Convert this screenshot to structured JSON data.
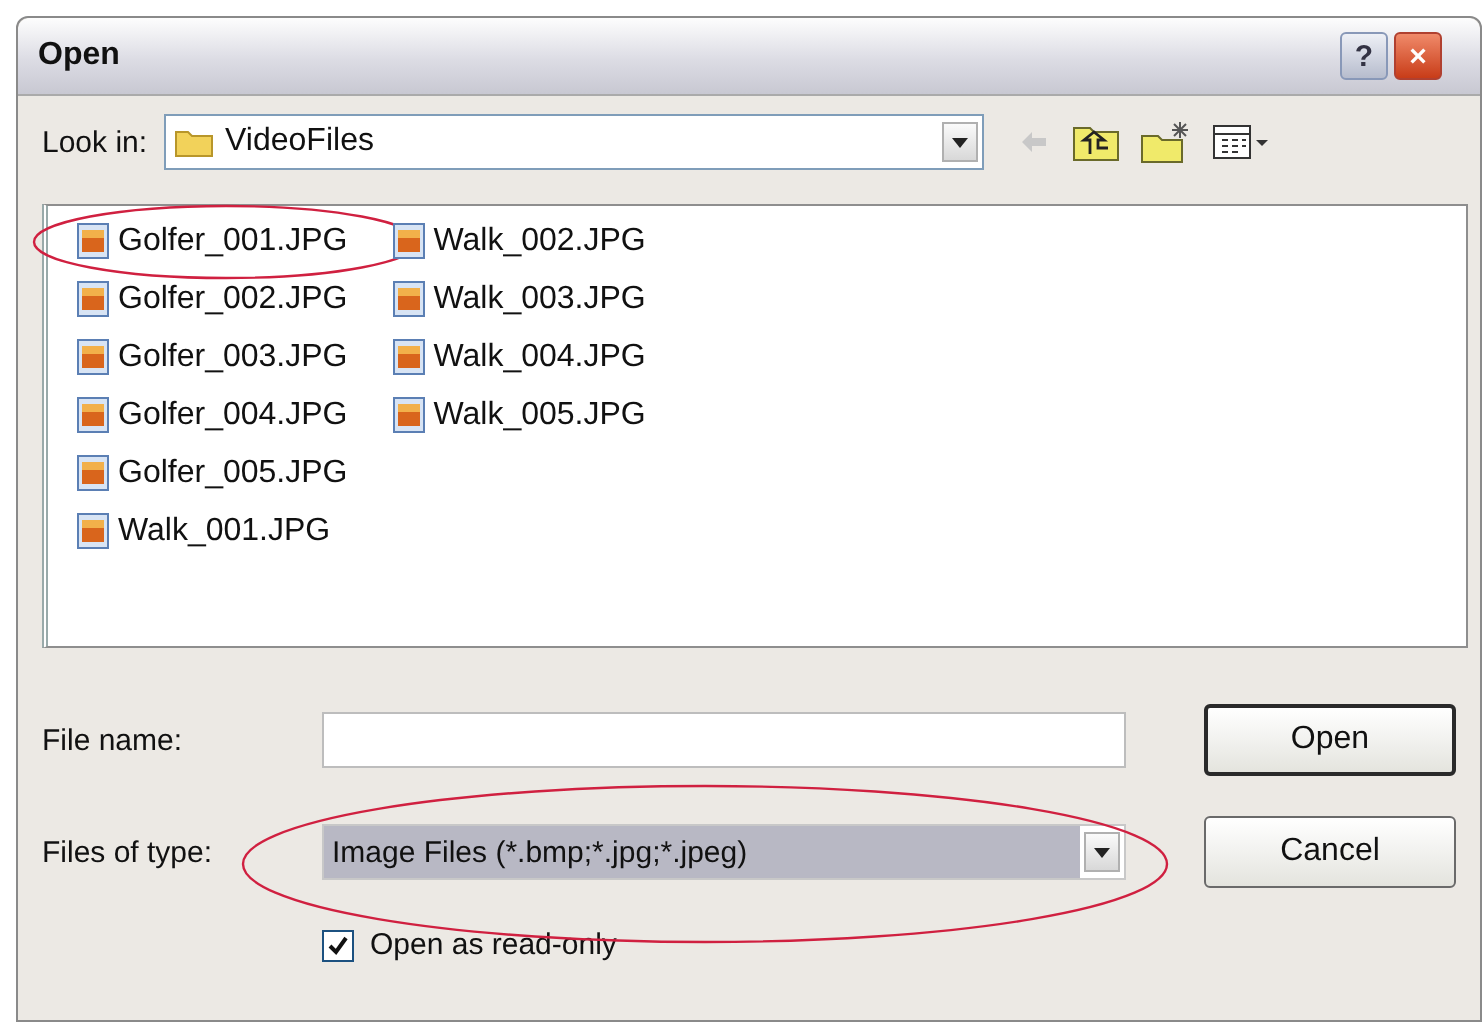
{
  "window": {
    "title": "Open",
    "buttons": [
      {
        "kind": "help",
        "glyph": "?"
      },
      {
        "kind": "close",
        "glyph": "×"
      }
    ]
  },
  "look_in": {
    "label": "Look in:",
    "value": "VideoFiles"
  },
  "files": [
    {
      "name": "Golfer_001.JPG",
      "circled": true
    },
    {
      "name": "Golfer_002.JPG",
      "circled": false
    },
    {
      "name": "Golfer_003.JPG",
      "circled": false
    },
    {
      "name": "Golfer_004.JPG",
      "circled": false
    },
    {
      "name": "Golfer_005.JPG",
      "circled": false
    },
    {
      "name": "Walk_001.JPG",
      "circled": false
    },
    {
      "name": "Walk_002.JPG",
      "circled": false
    },
    {
      "name": "Walk_003.JPG",
      "circled": false
    },
    {
      "name": "Walk_004.JPG",
      "circled": false
    },
    {
      "name": "Walk_005.JPG",
      "circled": false
    }
  ],
  "file_name": {
    "label": "File name:"
  },
  "file_type": {
    "label": "Files of type:",
    "value": "Image Files (*.bmp;*.jpg;*.jpeg)",
    "circled": true
  },
  "read_only": {
    "label": "Open as read-only",
    "checked": true
  },
  "buttons": [
    {
      "label": "Open",
      "default": true
    },
    {
      "label": "Cancel",
      "default": false
    }
  ]
}
